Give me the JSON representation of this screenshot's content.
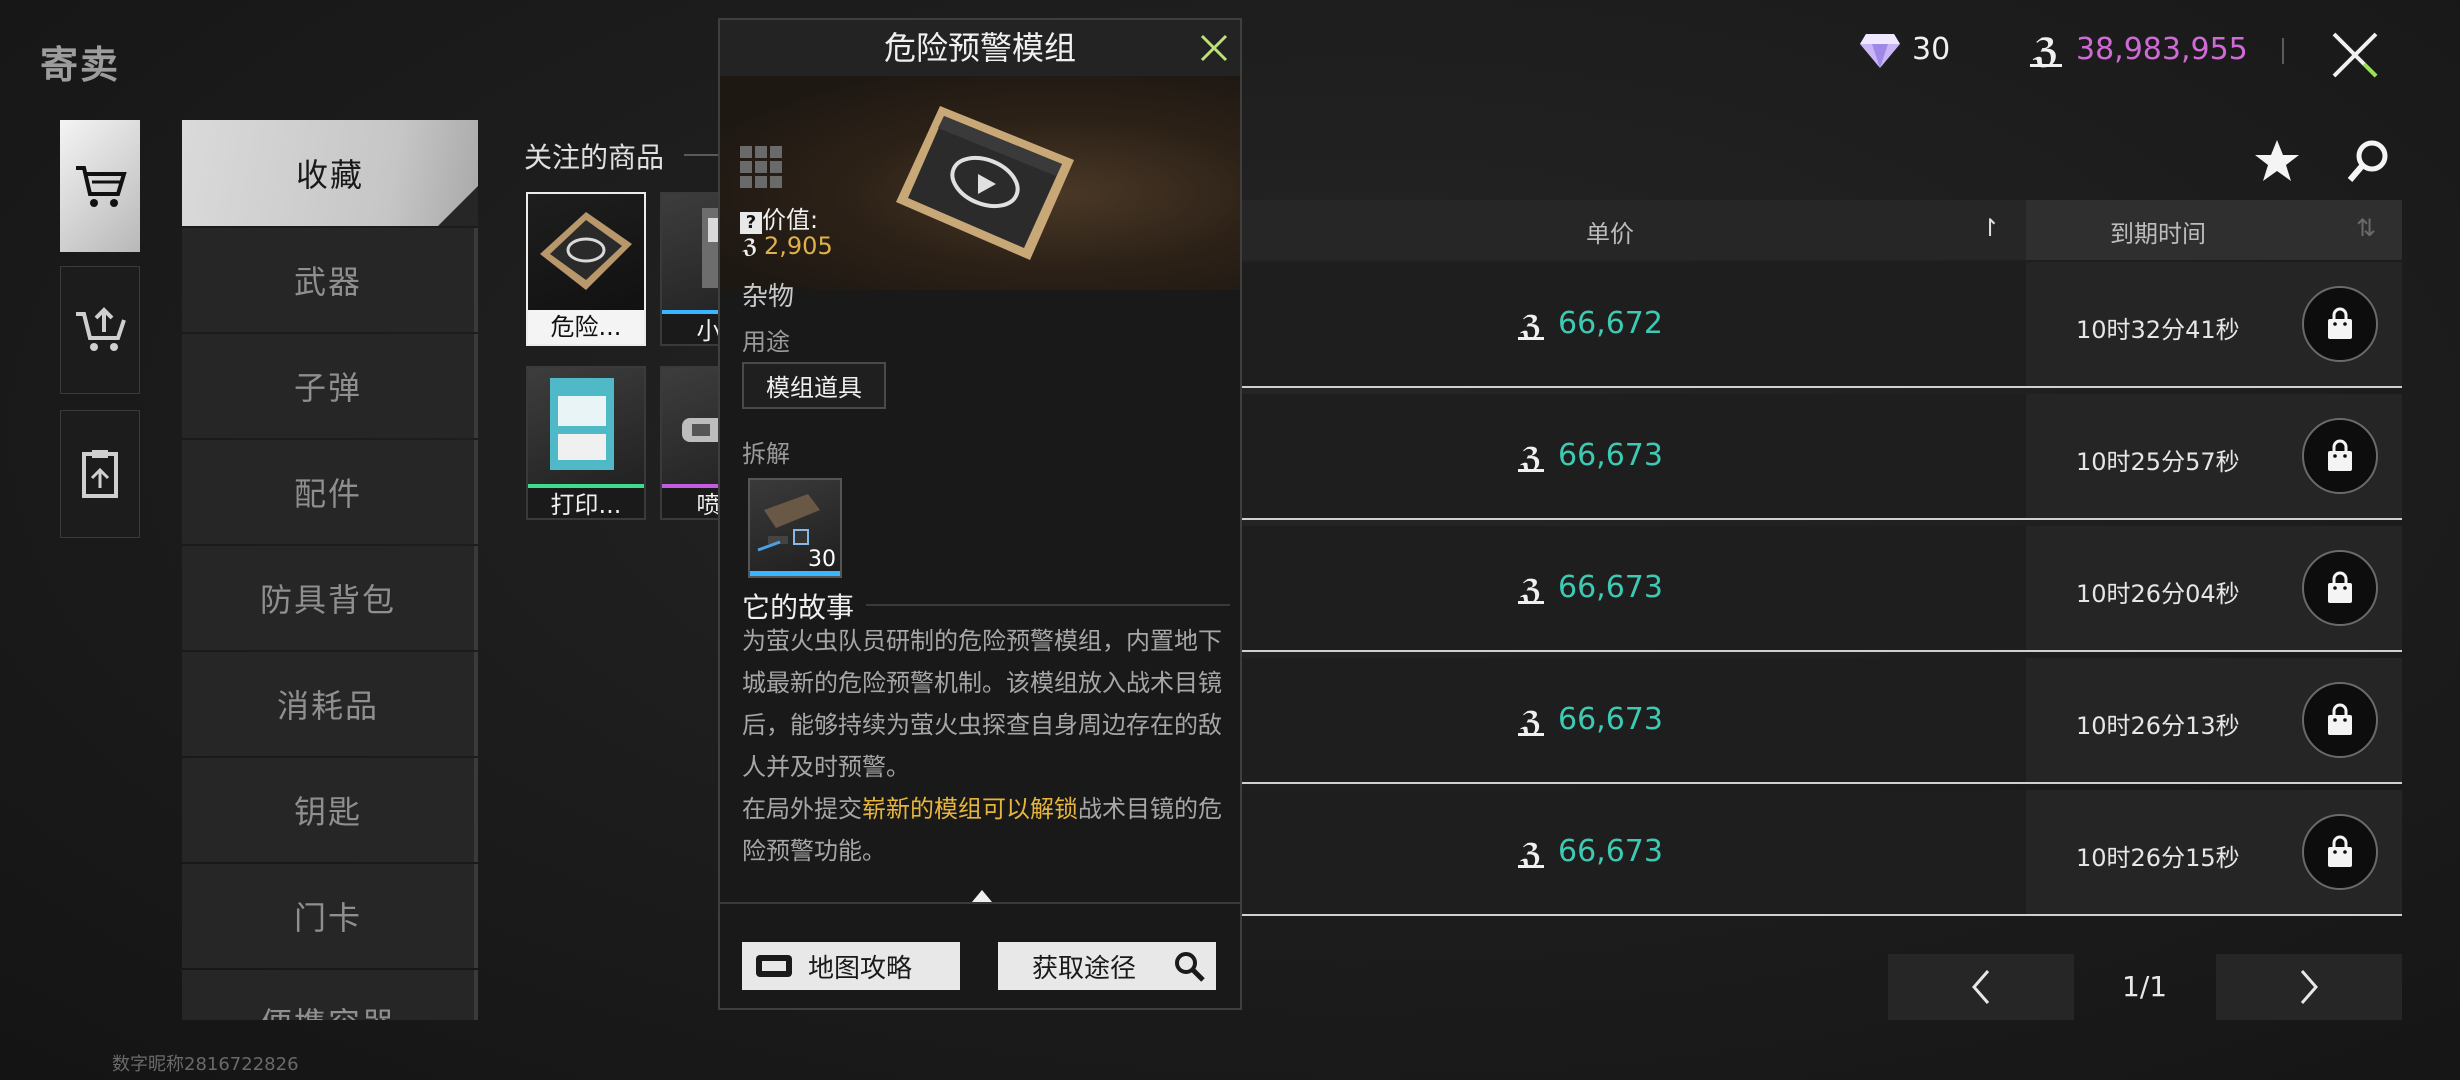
{
  "header": {
    "title": "寄卖",
    "diamonds": "30",
    "money": "38,983,955"
  },
  "categories": [
    "收藏",
    "武器",
    "子弹",
    "配件",
    "防具背包",
    "消耗品",
    "钥匙",
    "门卡",
    "便携容器"
  ],
  "followed": {
    "label": "关注的商品",
    "items": [
      {
        "name": "危险..."
      },
      {
        "name": "小..."
      },
      {
        "name": "打印..."
      },
      {
        "name": "喷..."
      }
    ]
  },
  "table": {
    "price_header": "单价",
    "expire_header": "到期时间",
    "rows": [
      {
        "price": "66,672",
        "expire": "10时32分41秒"
      },
      {
        "price": "66,673",
        "expire": "10时25分57秒"
      },
      {
        "price": "66,673",
        "expire": "10时26分04秒"
      },
      {
        "price": "66,673",
        "expire": "10时26分13秒"
      },
      {
        "price": "66,673",
        "expire": "10时26分15秒"
      }
    ]
  },
  "pager": {
    "text": "1/1"
  },
  "footer": {
    "id_text": "数字昵称2816722826"
  },
  "popup": {
    "title": "危险预警模组",
    "value_label": "价值:",
    "value_amount": "2,905",
    "category": "杂物",
    "usage_label": "用途",
    "usage_tag": "模组道具",
    "dismantle_label": "拆解",
    "dismantle_count": "30",
    "story_title": "它的故事",
    "story_p1": "为萤火虫队员研制的危险预警模组，内置地下城最新的危险预警机制。该模组放入战术目镜后，能够持续为萤火虫探查自身周边存在的敌人并及时预警。",
    "story_p2_before": "在局外提交",
    "story_p2_highlight": "崭新的模组可以解锁",
    "story_p2_after": "战术目镜的危险预警功能。",
    "map_button": "地图攻略",
    "obtain_button": "获取途径"
  },
  "colors": {
    "price_teal": "#3ec9b3",
    "money_purple": "#d06ad6",
    "highlight_gold": "#e7b53c"
  }
}
